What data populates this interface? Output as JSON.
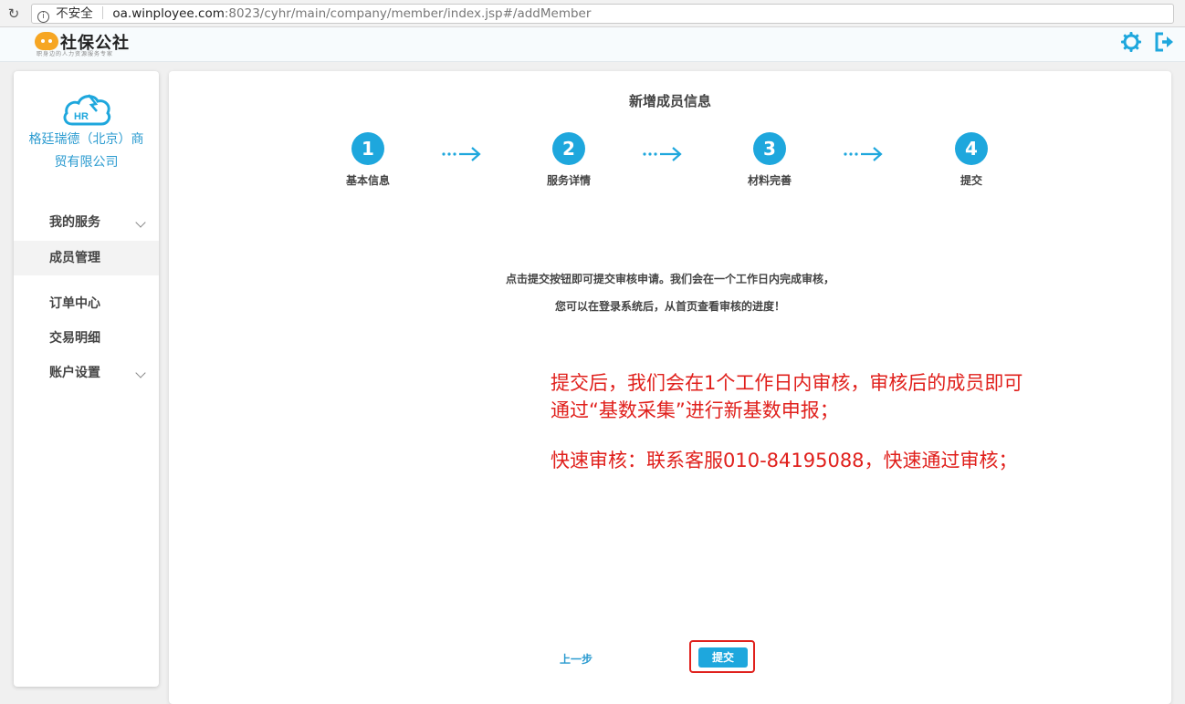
{
  "browser": {
    "insecure_label": "不安全",
    "url_host": "oa.winployee.com",
    "url_path": ":8023/cyhr/main/company/member/index.jsp#/addMember"
  },
  "header": {
    "logo_text": "社保公社",
    "logo_subtitle": "职身边的人力资源服务专家",
    "icons": [
      "gear-icon",
      "logout-icon"
    ],
    "accent_color": "#1ea7dd"
  },
  "sidebar": {
    "company_name": "格廷瑞德（北京）商贸有限公司",
    "items": [
      {
        "label": "我的服务",
        "expandable": true
      },
      {
        "label": "成员管理",
        "active": true
      },
      {
        "label": "订单中心"
      },
      {
        "label": "交易明细"
      },
      {
        "label": "账户设置",
        "expandable": true
      }
    ]
  },
  "main": {
    "title": "新增成员信息",
    "steps": [
      {
        "num": "1",
        "label": "基本信息"
      },
      {
        "num": "2",
        "label": "服务详情"
      },
      {
        "num": "3",
        "label": "材料完善"
      },
      {
        "num": "4",
        "label": "提交"
      }
    ],
    "message_line1": "点击提交按钮即可提交审核申请。我们会在一个工作日内完成审核，",
    "message_line2": "您可以在登录系统后，从首页查看审核的进度！",
    "annotation_line1": "提交后，我们会在1个工作日内审核，审核后的成员即可",
    "annotation_line2": "通过“基数采集”进行新基数申报；",
    "annotation_line3": "快速审核：联系客服010-84195088，快速通过审核；",
    "prev_label": "上一步",
    "submit_label": "提交"
  }
}
